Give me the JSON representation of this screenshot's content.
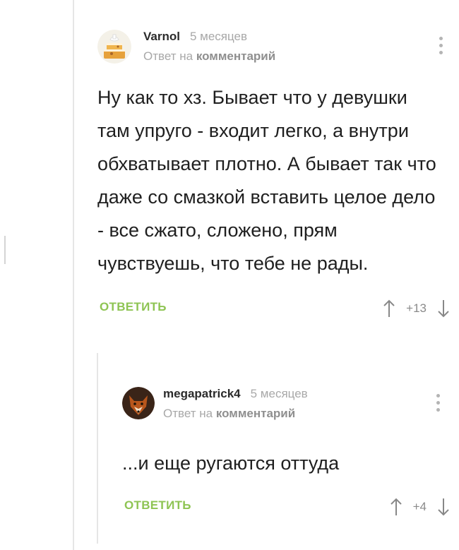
{
  "comments": [
    {
      "author": "Varnol",
      "time": "5 месяцев",
      "reply_prefix": "Ответ на",
      "reply_target": "комментарий",
      "text": "Ну как то хз. Бывает что у девушки там упруго - входит легко, а внутри обхватывает плотно. А бывает так что даже со смазкой вставить целое дело - все сжато, сложено, прям чувствуешь, что тебе не рады.",
      "reply_label": "ОТВЕТИТЬ",
      "score": "+13"
    },
    {
      "author": "megapatrick4",
      "time": "5 месяцев",
      "reply_prefix": "Ответ на",
      "reply_target": "комментарий",
      "text": "...и еще ругаются оттуда",
      "reply_label": "ОТВЕТИТЬ",
      "score": "+4"
    }
  ],
  "colors": {
    "accent": "#8ec453",
    "muted": "#a8a8a8",
    "thread_line": "#e6e6e6"
  }
}
